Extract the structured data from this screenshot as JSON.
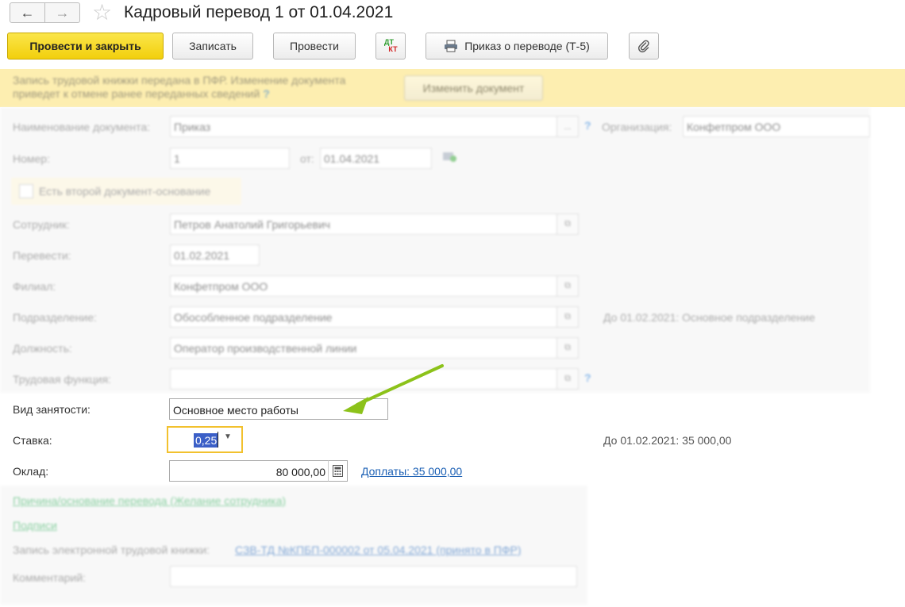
{
  "window": {
    "title": "Кадровый перевод 1 от 01.04.2021",
    "back_icon": "arrow-left-icon",
    "forward_icon": "arrow-right-icon",
    "favorite_icon": "star-icon"
  },
  "toolbar": {
    "post_close": "Провести и закрыть",
    "save": "Записать",
    "post": "Провести",
    "dt": "ДТ",
    "kt": "КТ",
    "print_order": "Приказ о переводе (Т-5)"
  },
  "banner": {
    "text": "Запись трудовой книжки передана в ПФР. Изменение документа приведет к отмене ранее переданных сведений",
    "help": "?",
    "change_button": "Изменить документ",
    "bg_color": "#fdeeb0"
  },
  "form": {
    "doc_name_label": "Наименование документа:",
    "doc_name_value": "Приказ",
    "doc_name_more": "...",
    "org_label": "Организация:",
    "org_value": "Конфетпром ООО",
    "number_label": "Номер:",
    "number_value": "1",
    "date_label": "от:",
    "date_value": "01.04.2021",
    "second_basis_label": "Есть второй документ-основание",
    "employee_label": "Сотрудник:",
    "employee_value": "Петров Анатолий Григорьевич",
    "transfer_label": "Перевести:",
    "transfer_value": "01.02.2021",
    "branch_label": "Филиал:",
    "branch_value": "Конфетпром ООО",
    "dept_label": "Подразделение:",
    "dept_value": "Обособленное подразделение",
    "dept_hint": "До 01.02.2021: Основное подразделение",
    "position_label": "Должность:",
    "position_value": "Оператор производственной линии",
    "labor_function_label": "Трудовая функция:",
    "labor_function_value": "",
    "employment_type_label": "Вид занятости:",
    "employment_type_value": "Основное место работы",
    "rate_label": "Ставка:",
    "rate_value": "0,25",
    "rate_hint": "До 01.02.2021: 35 000,00",
    "salary_label": "Оклад:",
    "salary_value": "80 000,00",
    "allowances_link": "Доплаты: 35 000,00",
    "reason_link": "Причина/основание перевода (Желание сотрудника)",
    "signatures_link": "Подписи",
    "etk_label": "Запись электронной трудовой книжки:",
    "etk_link": "СЗВ-ТД №КПБП-000002 от 05.04.2021 (принято в ПФР)",
    "comment_label": "Комментарий:",
    "comment_value": ""
  },
  "colors": {
    "primary_button": "#f2cf0c",
    "focus_border": "#f2c12e",
    "arrow": "#8cc21a",
    "link_green": "#2aaa55",
    "link_blue": "#1a5fb4"
  }
}
